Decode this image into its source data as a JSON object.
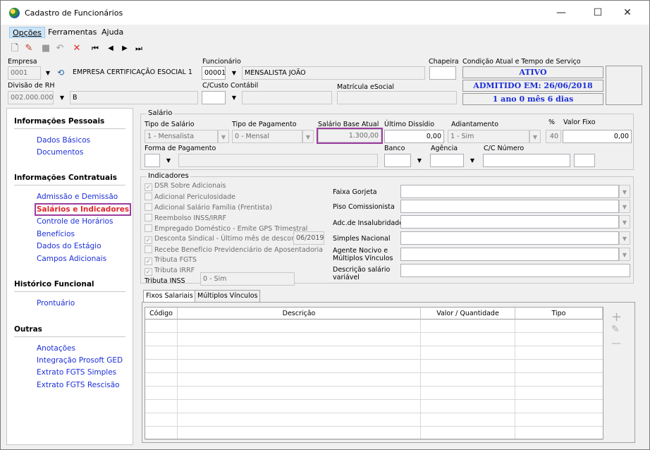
{
  "window": {
    "title": "Cadastro de Funcionários",
    "minimize": "—",
    "maximize": "☐",
    "close": "✕"
  },
  "menu": [
    "Opções",
    "Ferramentas",
    "Ajuda"
  ],
  "toolbar": {
    "new": "🗋",
    "edit": "✎",
    "save": "■",
    "undo": "↶",
    "delete": "✕",
    "first": "⏮",
    "prev": "◀",
    "next": "▶",
    "last": "⏭"
  },
  "header": {
    "empresa_label": "Empresa",
    "empresa_code": "0001",
    "empresa_name": "EMPRESA CERTIFICAÇÃO ESOCIAL 1",
    "funcionario_label": "Funcionário",
    "funcionario_code": "00001",
    "funcionario_name": "MENSALISTA JOÃO",
    "chapeira_label": "Chapeira",
    "chapeira_value": "",
    "condicao_label": "Condição Atual e Tempo de Serviço",
    "status": "ATIVO",
    "admitido": "ADMITIDO EM: 26/06/2018",
    "tempo": "1 ano 0 mês 6 dias",
    "divisao_label": "Divisão de RH",
    "divisao_code": "002.000.000",
    "divisao_name": "B",
    "custo_label": "C/Custo Contábil",
    "matricula_label": "Matrícula eSocial"
  },
  "sidebar": {
    "sections": [
      {
        "title": "Informações Pessoais",
        "items": [
          "Dados Básicos",
          "Documentos"
        ]
      },
      {
        "title": "Informações Contratuais",
        "items": [
          "Admissão e Demissão",
          "Salários e Indicadores",
          "Controle de Horários",
          "Benefícios",
          "Dados do Estágio",
          "Campos Adicionais"
        ]
      },
      {
        "title": "Histórico Funcional",
        "items": [
          "Prontuário"
        ]
      },
      {
        "title": "Outras",
        "items": [
          "Anotações",
          "Integração Prosoft GED",
          "Extrato FGTS Simples",
          "Extrato FGTS Rescisão"
        ]
      }
    ],
    "selected": "Salários e Indicadores"
  },
  "salario": {
    "group": "Salário",
    "tipo_salario_label": "Tipo de Salário",
    "tipo_salario": "1 - Mensalista",
    "tipo_pagamento_label": "Tipo de Pagamento",
    "tipo_pagamento": "0 - Mensal",
    "base_label": "Salário Base Atual",
    "base_value": "1.300,00",
    "dissidio_label": "Último Dissídio",
    "dissidio_value": "0,00",
    "adiantamento_label": "Adiantamento",
    "adiantamento": "1 - Sim",
    "pct_label": "%",
    "pct_value": "40",
    "valor_fixo_label": "Valor Fixo",
    "valor_fixo": "0,00",
    "forma_label": "Forma de Pagamento",
    "banco_label": "Banco",
    "agencia_label": "Agência",
    "cc_label": "C/C Número"
  },
  "indicadores": {
    "group": "Indicadores",
    "checks": [
      {
        "label": "DSR Sobre Adicionais",
        "checked": true
      },
      {
        "label": "Adicional Periculosidade",
        "checked": false
      },
      {
        "label": "Adicional Salário Família (Frentista)",
        "checked": false
      },
      {
        "label": "Reembolso INSS/IRRF",
        "checked": false
      },
      {
        "label": "Empregado Doméstico - Emite GPS Trimestral",
        "checked": false
      },
      {
        "label": "Desconta Sindical - Último mês de desconto",
        "checked": true
      },
      {
        "label": "Recebe Benefício Previdenciário de Aposentadoria",
        "checked": false
      },
      {
        "label": "Tributa FGTS",
        "checked": true
      },
      {
        "label": "Tributa IRRF",
        "checked": true
      }
    ],
    "sindical_mes": "06/2019",
    "tributa_inss_label": "Tributa INSS",
    "tributa_inss": "0 - Sim",
    "right": [
      "Faixa Gorjeta",
      "Piso Comissionista",
      "Adc.de Insalubridade",
      "Simples Nacional",
      "Agente Nocivo e Múltiplos Vínculos",
      "Descrição salário variável"
    ]
  },
  "tabs": [
    "Fixos Salariais",
    "Múltiplos Vínculos"
  ],
  "grid": {
    "headers": [
      "Código",
      "Descrição",
      "Valor / Quantidade",
      "Tipo"
    ]
  },
  "side_buttons": {
    "add": "+",
    "edit": "✎",
    "remove": "—"
  }
}
